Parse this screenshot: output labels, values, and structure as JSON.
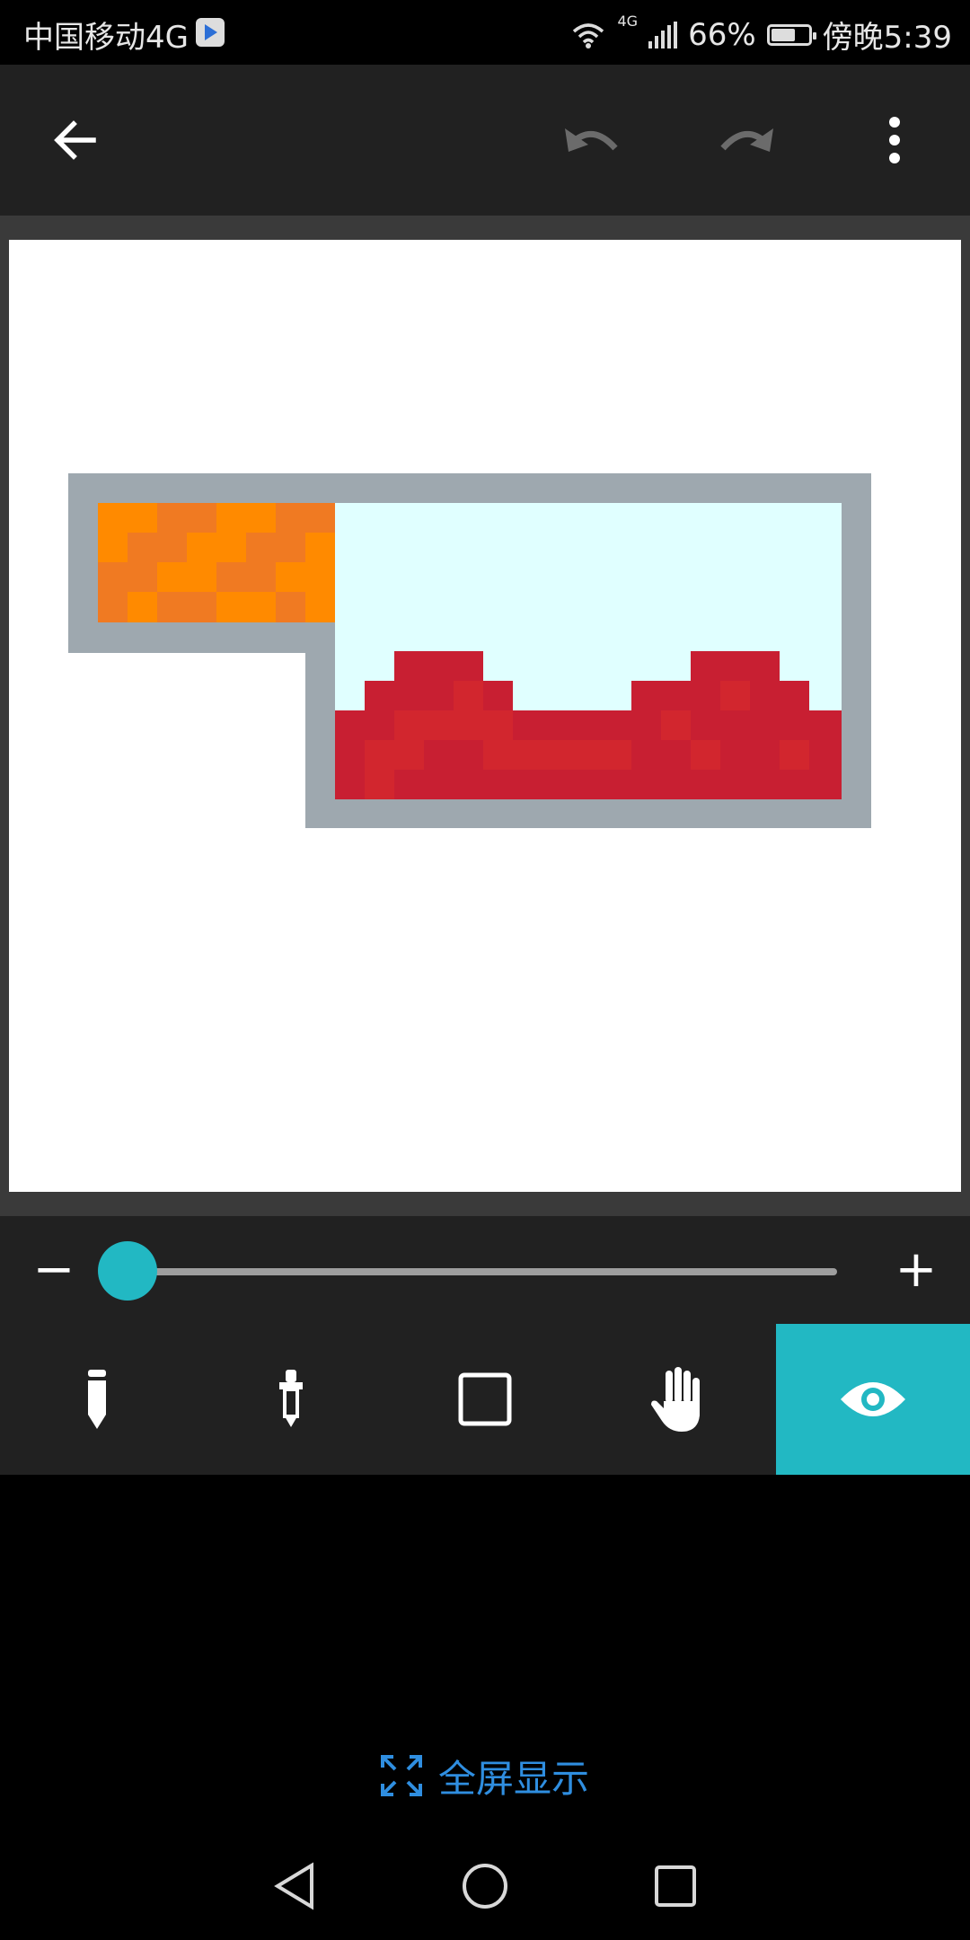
{
  "status": {
    "carrier": "中国移动4G",
    "network": "4G",
    "battery_percent": "66%",
    "time": "傍晚5:39"
  },
  "toolbar": {
    "back_icon": "arrow-left-icon",
    "undo_icon": "undo-icon",
    "redo_icon": "redo-icon",
    "more_icon": "more-vert-icon"
  },
  "canvas": {
    "background": "#ffffff",
    "frame_color": "#9ea8af",
    "sky_color": "#e0ffff",
    "water_colors": [
      "#c81f32",
      "#d2262e"
    ],
    "lava_colors": [
      "#ff8a00",
      "#f07a22"
    ]
  },
  "zoom": {
    "minus_label": "−",
    "plus_label": "+",
    "level_fraction": 0.0
  },
  "tools": [
    {
      "name": "pencil-icon",
      "active": false
    },
    {
      "name": "eyedropper-icon",
      "active": false
    },
    {
      "name": "square-icon",
      "active": false
    },
    {
      "name": "hand-icon",
      "active": false
    },
    {
      "name": "eye-icon",
      "active": true
    }
  ],
  "accent_color": "#22b8c3",
  "fullscreen": {
    "icon": "expand-icon",
    "label": "全屏显示",
    "color": "#2f8ee0"
  },
  "nav": {
    "back_icon": "nav-back-icon",
    "home_icon": "nav-home-icon",
    "recents_icon": "nav-recents-icon"
  }
}
